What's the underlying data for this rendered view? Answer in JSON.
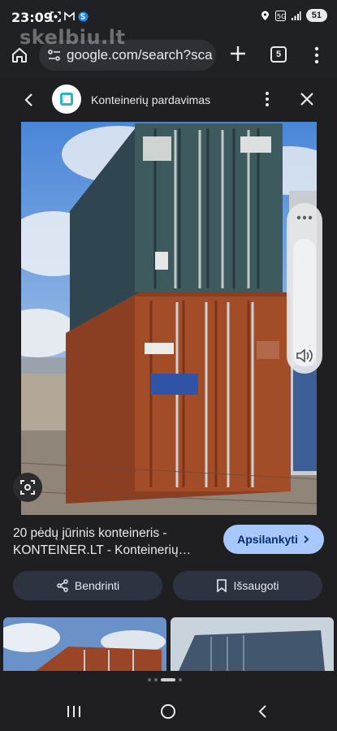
{
  "status_bar": {
    "time": "23:09",
    "battery": "51"
  },
  "watermark": "skelbiu.lt",
  "browser": {
    "url": "google.com/search?sca",
    "tab_count": "5"
  },
  "lens_header": {
    "site_title": "Konteinerių pardavimas"
  },
  "main_image": {
    "description_icon": "shipping-container-photo"
  },
  "result": {
    "title": "20 pėdų jūrinis konteineris - KONTEINER.LT - Konteinerių…",
    "visit_label": "Apsilankyti",
    "share_label": "Bendrinti",
    "save_label": "Išsaugoti"
  },
  "colors": {
    "background": "#1f1f22",
    "accent_button": "#a8c7fa",
    "action_button": "#2d3340"
  }
}
